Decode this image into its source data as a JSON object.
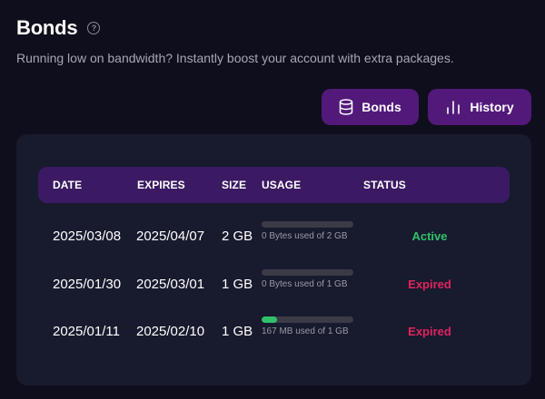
{
  "header": {
    "title": "Bonds",
    "help_glyph": "?",
    "subtitle": "Running low on bandwidth? Instantly boost your account with extra packages."
  },
  "buttons": {
    "bonds_label": "Bonds",
    "bonds_icon": "database-icon",
    "history_label": "History",
    "history_icon": "bar-chart-icon"
  },
  "table": {
    "columns": [
      "DATE",
      "EXPIRES",
      "SIZE",
      "USAGE",
      "STATUS"
    ],
    "rows": [
      {
        "date": "2025/03/08",
        "expires": "2025/04/07",
        "size": "2 GB",
        "usage_fraction": 0,
        "usage_text": "0 Bytes used of 2 GB",
        "status": "Active"
      },
      {
        "date": "2025/01/30",
        "expires": "2025/03/01",
        "size": "1 GB",
        "usage_fraction": 0,
        "usage_text": "0 Bytes used of 1 GB",
        "status": "Expired"
      },
      {
        "date": "2025/01/11",
        "expires": "2025/02/10",
        "size": "1 GB",
        "usage_fraction": 0.167,
        "usage_text": "167 MB used of 1 GB",
        "status": "Expired"
      }
    ]
  },
  "colors": {
    "background": "#0f0e1c",
    "card": "#181a2e",
    "accent": "#52197a",
    "header_row": "#3b1a63",
    "active": "#2ec36a",
    "expired": "#e0245e",
    "bar_fill": "#2ec36a"
  }
}
